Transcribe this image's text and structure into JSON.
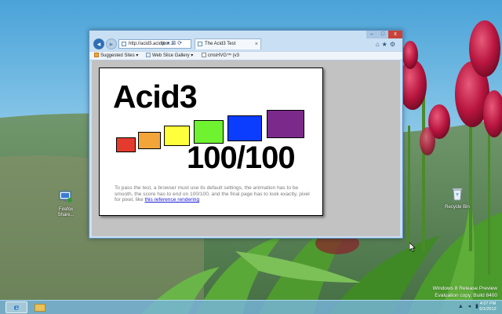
{
  "browser": {
    "address_url": "http://acid3.acidtes...",
    "address_controls": "ρ ▾ ⊠ ⟳",
    "tab_title": "The Acid3 Test",
    "tab_close": "×",
    "caption": {
      "minimize": "–",
      "maximize": "□",
      "close": "x"
    },
    "tools": "⌂★⚙"
  },
  "favorites_bar": {
    "items": [
      {
        "label": "Suggested Sites ▾",
        "icon": "suggested-sites-icon"
      },
      {
        "label": "Web Slice Gallery ▾",
        "icon": "web-slice-icon"
      },
      {
        "label": "cmsHVG™ (v3",
        "icon": "page-icon"
      }
    ]
  },
  "acid3": {
    "title": "Acid3",
    "score": "100/100",
    "explanation": "To pass the test, a browser must use its default settings, the animation has to be smooth, the score has to end on 100/100, and the final page has to look exactly, pixel for pixel, like ",
    "link_text": "this reference rendering",
    "bucket_colors": [
      "#e33b2e",
      "#f3a53a",
      "#ffff3c",
      "#6ff230",
      "#0a3dff",
      "#7b2a8c"
    ]
  },
  "desktop": {
    "icons": [
      {
        "label": "Firefox\nShare...",
        "icon": "network-icon"
      },
      {
        "label": "Recycle Bin",
        "icon": "recycle-bin-icon"
      }
    ],
    "watermark_line1": "Windows 8 Release Preview",
    "watermark_line2": "Evaluation copy. Build 8400"
  },
  "taskbar": {
    "ie_glyph": "e",
    "tray_icons": "▲ ◂ ▮",
    "time": "4:07 PM",
    "date": "6/1/2012"
  },
  "colors": {
    "window_frame": "#c9dff3",
    "viewport_bg": "#c2c2c2",
    "link": "#1a1ad6",
    "close_button": "#c7433a"
  }
}
